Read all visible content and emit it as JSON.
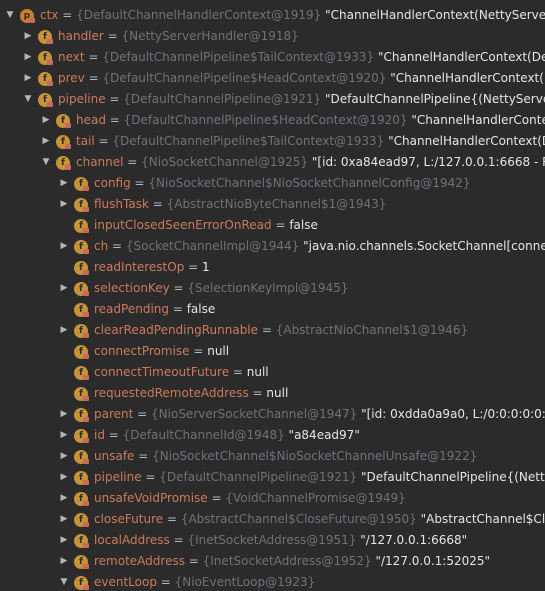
{
  "rows": [
    {
      "name": "ctx",
      "type": "{DefaultChannelHandlerContext@1919}",
      "value": "\"ChannelHandlerContext(NettyServerHand",
      "icon": "p",
      "expanded": true
    },
    {
      "name": "handler",
      "type": "{NettyServerHandler@1918}",
      "value": "",
      "icon": "f",
      "expanded": false
    },
    {
      "name": "next",
      "type": "{DefaultChannelPipeline$TailContext@1933}",
      "value": "\"ChannelHandlerContext(DefaultCh",
      "icon": "f",
      "expanded": false
    },
    {
      "name": "prev",
      "type": "{DefaultChannelPipeline$HeadContext@1920}",
      "value": "\"ChannelHandlerContext(Defau",
      "icon": "f",
      "expanded": false
    },
    {
      "name": "pipeline",
      "type": "{DefaultChannelPipeline@1921}",
      "value": "\"DefaultChannelPipeline{(NettyServerHand",
      "icon": "f",
      "expanded": true
    },
    {
      "name": "head",
      "type": "{DefaultChannelPipeline$HeadContext@1920}",
      "value": "\"ChannelHandlerContext(De",
      "icon": "f",
      "expanded": false
    },
    {
      "name": "tail",
      "type": "{DefaultChannelPipeline$TailContext@1933}",
      "value": "\"ChannelHandlerContext(Defaul",
      "icon": "f",
      "expanded": false
    },
    {
      "name": "channel",
      "type": "{NioSocketChannel@1925}",
      "value": "\"[id: 0xa84ead97, L:/127.0.0.1:6668 - R:/127",
      "icon": "f",
      "expanded": true
    },
    {
      "name": "config",
      "type": "{NioSocketChannel$NioSocketChannelConfig@1942}",
      "value": "",
      "icon": "f",
      "expanded": false
    },
    {
      "name": "flushTask",
      "type": "{AbstractNioByteChannel$1@1943}",
      "value": "",
      "icon": "f",
      "expanded": false
    },
    {
      "name": "inputClosedSeenErrorOnRead",
      "type": "",
      "value": "false",
      "icon": "f",
      "leaf": true
    },
    {
      "name": "ch",
      "type": "{SocketChannelImpl@1944}",
      "value": "\"java.nio.channels.SocketChannel[connected",
      "icon": "f",
      "expanded": false
    },
    {
      "name": "readInterestOp",
      "type": "",
      "value": "1",
      "icon": "f",
      "leaf": true
    },
    {
      "name": "selectionKey",
      "type": "{SelectionKeyImpl@1945}",
      "value": "",
      "icon": "f",
      "expanded": false
    },
    {
      "name": "readPending",
      "type": "",
      "value": "false",
      "icon": "f",
      "leaf": true
    },
    {
      "name": "clearReadPendingRunnable",
      "type": "{AbstractNioChannel$1@1946}",
      "value": "",
      "icon": "f",
      "expanded": false
    },
    {
      "name": "connectPromise",
      "type": "",
      "value": "null",
      "icon": "f",
      "leaf": true
    },
    {
      "name": "connectTimeoutFuture",
      "type": "",
      "value": "null",
      "icon": "f",
      "leaf": true
    },
    {
      "name": "requestedRemoteAddress",
      "type": "",
      "value": "null",
      "icon": "f",
      "leaf": true
    },
    {
      "name": "parent",
      "type": "{NioServerSocketChannel@1947}",
      "value": "\"[id: 0xdda0a9a0, L:/0:0:0:0:0:0:0",
      "icon": "f",
      "expanded": false
    },
    {
      "name": "id",
      "type": "{DefaultChannelId@1948}",
      "value": "\"a84ead97\"",
      "icon": "f",
      "expanded": false
    },
    {
      "name": "unsafe",
      "type": "{NioSocketChannel$NioSocketChannelUnsafe@1922}",
      "value": "",
      "icon": "f",
      "expanded": false
    },
    {
      "name": "pipeline",
      "type": "{DefaultChannelPipeline@1921}",
      "value": "\"DefaultChannelPipeline{(NettyServer",
      "icon": "f",
      "expanded": false
    },
    {
      "name": "unsafeVoidPromise",
      "type": "{VoidChannelPromise@1949}",
      "value": "",
      "icon": "f",
      "expanded": false
    },
    {
      "name": "closeFuture",
      "type": "{AbstractChannel$CloseFuture@1950}",
      "value": "\"AbstractChannel$CloseFu",
      "icon": "f",
      "expanded": false
    },
    {
      "name": "localAddress",
      "type": "{InetSocketAddress@1951}",
      "value": "\"/127.0.0.1:6668\"",
      "icon": "f",
      "expanded": false
    },
    {
      "name": "remoteAddress",
      "type": "{InetSocketAddress@1952}",
      "value": "\"/127.0.0.1:52025\"",
      "icon": "f",
      "expanded": false
    },
    {
      "name": "eventLoop",
      "type": "{NioEventLoop@1923}",
      "value": "",
      "icon": "f",
      "expanded": true
    }
  ]
}
